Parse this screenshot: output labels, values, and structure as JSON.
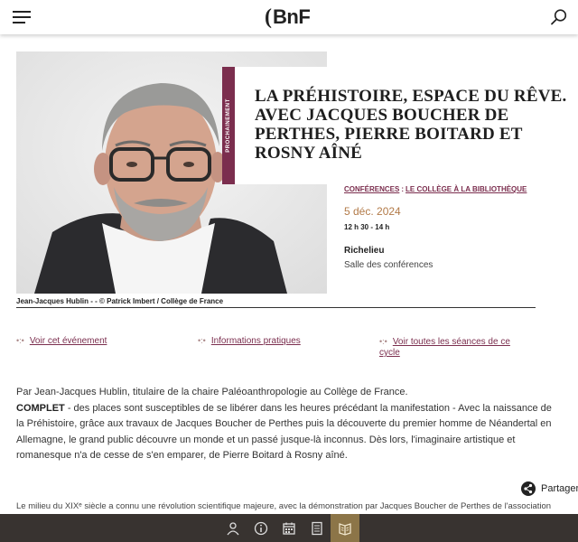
{
  "header": {
    "logo_bracket": "(",
    "logo_text": "BnF"
  },
  "hero": {
    "badge": "PROCHAINEMENT",
    "title": "LA PRÉHISTOIRE, ESPACE DU RÊVE. AVEC JACQUES BOUCHER DE PERTHES, PIERRE BOITARD ET ROSNY AÎNÉ",
    "caption": "Jean-Jacques Hublin - - © Patrick Imbert / Collège de France",
    "category1": "CONFÉRENCES",
    "category_sep": ":",
    "category2": "LE COLLÈGE À LA BIBLIOTHÈQUE",
    "date": "5 déc. 2024",
    "time": "12 h 30 - 14 h",
    "place": "Richelieu",
    "room": "Salle des conférences"
  },
  "links": {
    "dots": "•:•",
    "event": "Voir cet événement",
    "info": "Informations pratiques",
    "sessions": "Voir toutes les séances de ce cycle"
  },
  "body": {
    "line1": "Par Jean-Jacques Hublin, titulaire de la chaire Paléoanthropologie au Collège de France.",
    "complet": "COMPLET",
    "line2": " - des places sont susceptibles de se libérer dans les heures précédant la manifestation - Avec la naissance de la Préhistoire, grâce aux travaux de Jacques Boucher de Perthes puis la découverte du premier homme de Néandertal en Allemagne, le grand public découvre un monde et un passé jusque-là inconnus. Dès lors, l'imaginaire artistique et romanesque n'a de cesse de s'en emparer, de Pierre Boitard à Rosny aîné.",
    "intro": "Le milieu du XIXᵉ siècle a connu une révolution scientifique majeure, avec la démonstration par Jacques Boucher de Perthes de l'association"
  },
  "share": {
    "label": "Partager"
  },
  "colors": {
    "accent": "#7b2e4e",
    "date": "#b27a48",
    "bar": "#383330",
    "bar_active": "#8c7548"
  },
  "bottom_bar": {
    "icons": [
      "person-icon",
      "info-icon",
      "calendar-icon",
      "document-icon",
      "book-icon"
    ],
    "active_index": 4
  }
}
